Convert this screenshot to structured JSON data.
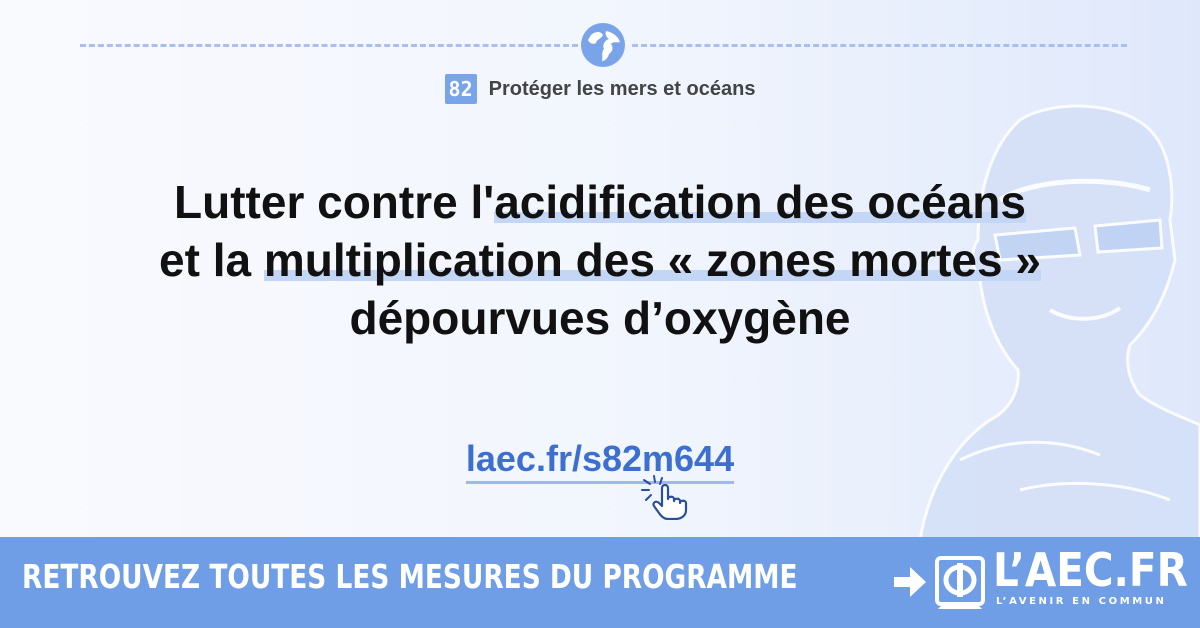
{
  "eyebrow": {
    "number": "82",
    "category": "Protéger les mers et océans"
  },
  "headline": {
    "line1_plain": "Lutter contre l'",
    "line1_highlight": "acidification des océans",
    "line2_plain": "et la ",
    "line2_highlight": "multiplication des « zones mortes »",
    "line3": "dépourvues d’oxygène"
  },
  "link": {
    "text": "laec.fr/s82m644"
  },
  "banner": {
    "cta": "RETROUVEZ TOUTES LES MESURES DU PROGRAMME",
    "logo_text": "L’AEC.FR",
    "logo_tagline": "L’AVENIR EN COMMUN"
  },
  "icons": {
    "section": "globe-icon",
    "cta_arrow": "arrow-right-icon",
    "link_cursor": "hand-pointer-icon",
    "brand": "phi-logo-icon"
  },
  "colors": {
    "accent": "#6f9ee6",
    "link": "#3d6fd1",
    "highlight": "#c4d6f5",
    "text": "#111111"
  }
}
